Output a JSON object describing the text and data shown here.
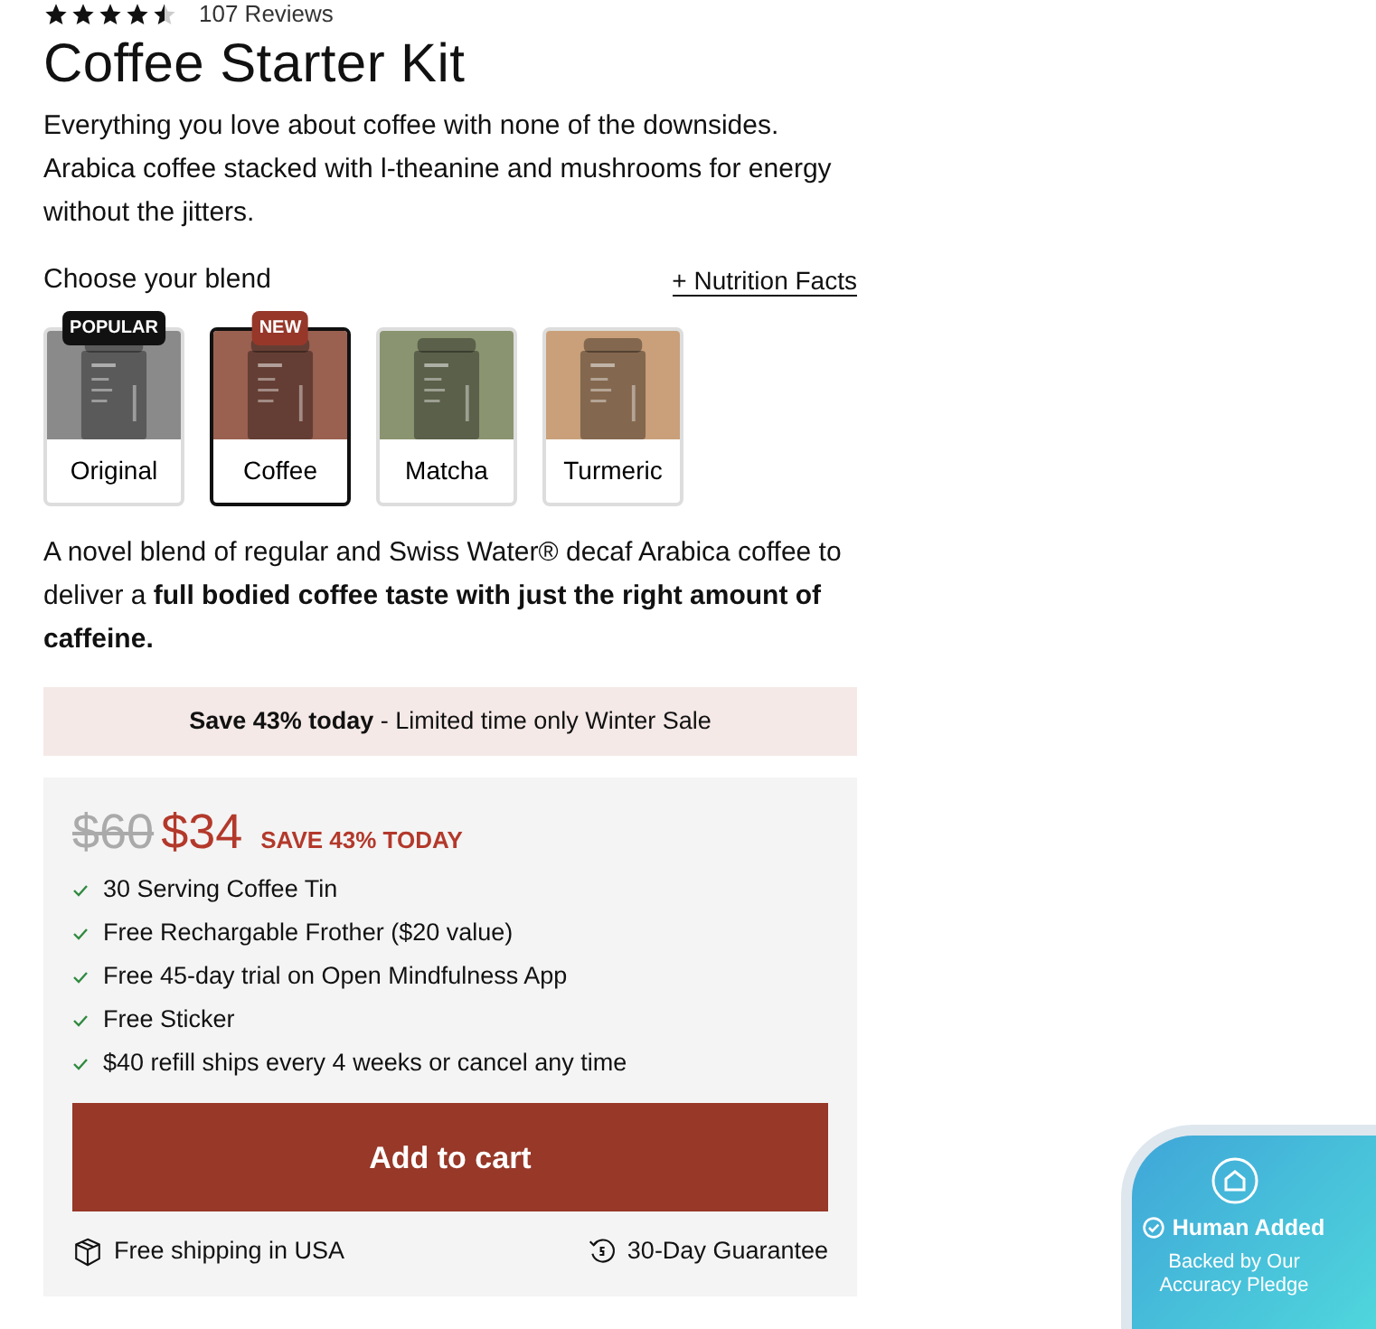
{
  "rating": {
    "stars": 4.5,
    "reviews": "107 Reviews"
  },
  "title": "Coffee Starter Kit",
  "description": "Everything you love about coffee with none of the downsides. Arabica coffee stacked with l-theanine and mushrooms for energy without the jitters.",
  "blend_label": "Choose your blend",
  "nutrition_link": "+ Nutrition Facts",
  "blends": [
    {
      "label": "Original",
      "badge": {
        "text": "POPULAR",
        "color": "#111111"
      },
      "color": "#8a8a8a",
      "selected": false
    },
    {
      "label": "Coffee",
      "badge": {
        "text": "NEW",
        "color": "#96372a"
      },
      "color": "#9a6050",
      "selected": true
    },
    {
      "label": "Matcha",
      "color": "#8a9470",
      "selected": false
    },
    {
      "label": "Turmeric",
      "color": "#c9a07a",
      "selected": false
    }
  ],
  "blend_description": "A novel blend of regular and Swiss Water® decaf Arabica coffee to deliver a **full bodied coffee taste with just the right amount of caffeine.**",
  "sale_banner": "**Save 43% today** - Limited time only Winter Sale",
  "price": {
    "old": "$60",
    "new": "$34",
    "save": "SAVE 43% TODAY"
  },
  "features": [
    "30 Serving Coffee Tin",
    "Free Rechargable Frother ($20 value)",
    "Free 45-day trial on Open Mindfulness App",
    "Free Sticker",
    "$40 refill ships every 4 weeks or cancel any time"
  ],
  "add_to_cart": "Add to cart",
  "perks": [
    {
      "kind": "shipping",
      "text": "Free shipping in USA"
    },
    {
      "kind": "guarantee",
      "text": "30-Day Guarantee"
    }
  ],
  "pledge": {
    "title": "Human Added",
    "text": "Backed by Our Accuracy Pledge"
  }
}
